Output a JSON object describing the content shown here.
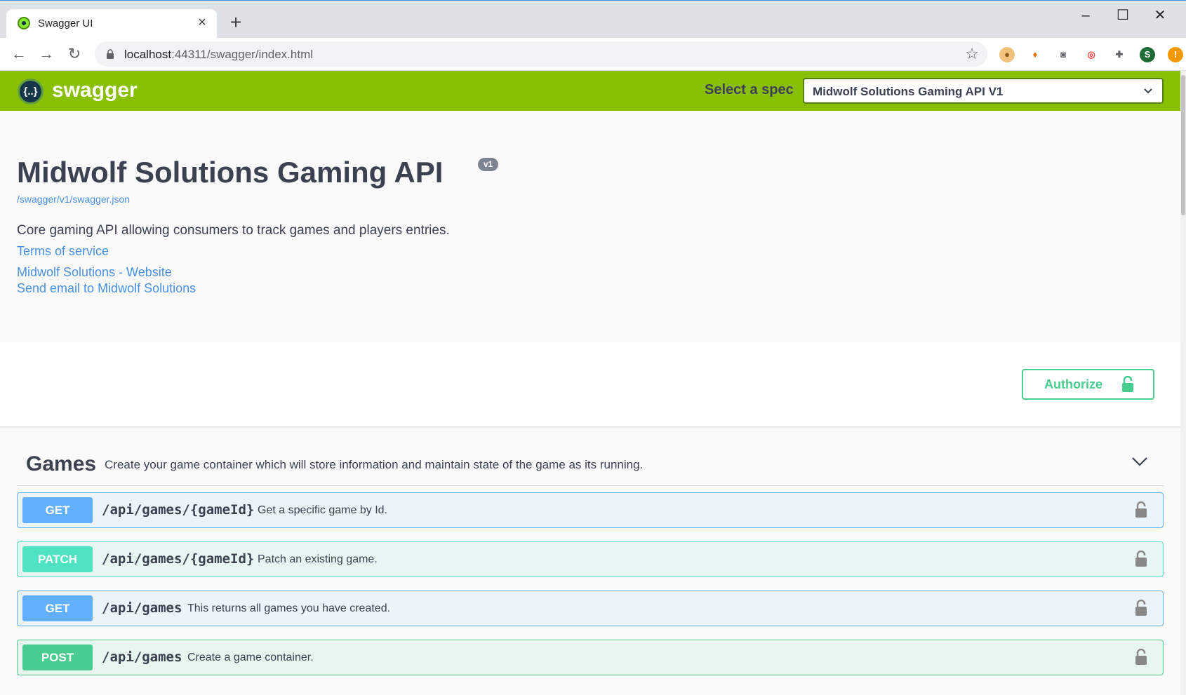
{
  "browser": {
    "tab_title": "Swagger UI",
    "url_host": "localhost",
    "url_rest": ":44311/swagger/index.html",
    "extensions": [
      "cookie-icon",
      "rocket-icon",
      "camera-icon",
      "swirl-icon",
      "puzzle-icon",
      "profile-avatar",
      "alert-icon"
    ],
    "profile_initial": "S",
    "alert_symbol": "!"
  },
  "topbar": {
    "brand": "swagger",
    "logo_glyph": "{..}",
    "spec_label": "Select a spec",
    "spec_value": "Midwolf Solutions Gaming API V1"
  },
  "info": {
    "title": "Midwolf Solutions Gaming API",
    "version": "v1",
    "spec_url": "/swagger/v1/swagger.json",
    "description": "Core gaming API allowing consumers to track games and players entries.",
    "terms": "Terms of service",
    "website": "Midwolf Solutions - Website",
    "email": "Send email to Midwolf Solutions"
  },
  "auth": {
    "label": "Authorize"
  },
  "tag": {
    "name": "Games",
    "description": "Create your game container which will store information and maintain state of the game as its running."
  },
  "operations": [
    {
      "method": "GET",
      "path": "/api/games/{gameId}",
      "summary": "Get a specific game by Id."
    },
    {
      "method": "PATCH",
      "path": "/api/games/{gameId}",
      "summary": "Patch an existing game."
    },
    {
      "method": "GET",
      "path": "/api/games",
      "summary": "This returns all games you have created."
    },
    {
      "method": "POST",
      "path": "/api/games",
      "summary": "Create a game container."
    }
  ],
  "colors": {
    "swagger_green": "#89bf04",
    "get": "#61affe",
    "patch": "#50e3c2",
    "post": "#49cc90",
    "link": "#4990e2"
  }
}
